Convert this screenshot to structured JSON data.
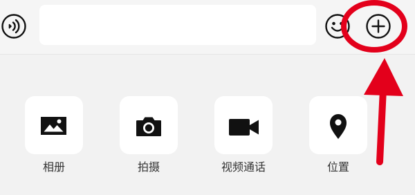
{
  "chat_input": {
    "text_value": "",
    "placeholder": ""
  },
  "buttons": {
    "voice_icon": "voice-icon",
    "emoji_icon": "emoji-icon",
    "more_icon": "plus-icon"
  },
  "more_panel": {
    "items": [
      {
        "label": "相册",
        "icon": "photo-album-icon"
      },
      {
        "label": "拍摄",
        "icon": "camera-icon"
      },
      {
        "label": "视频通话",
        "icon": "video-call-icon"
      },
      {
        "label": "位置",
        "icon": "location-pin-icon"
      }
    ]
  },
  "annotation": {
    "color": "#e3001b"
  }
}
